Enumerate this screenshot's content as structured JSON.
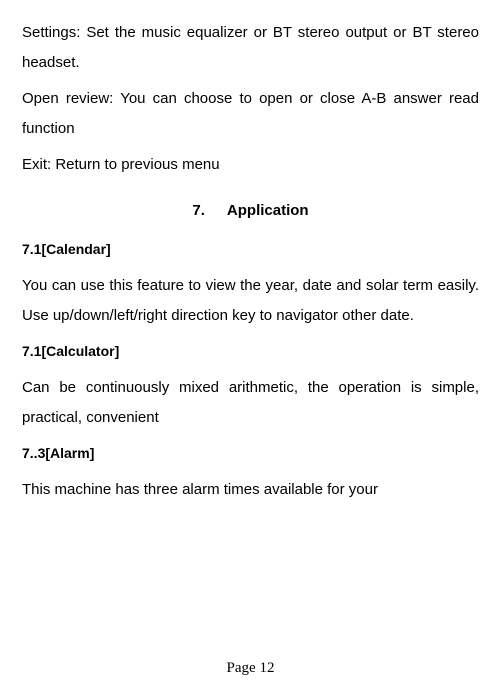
{
  "intro": {
    "settings_text": "Settings: Set the music equalizer or BT stereo output or BT stereo headset.",
    "open_review_text": "Open review: You can choose to open or close A-B answer read function",
    "exit_text": "Exit: Return to previous menu"
  },
  "section": {
    "number": "7.",
    "title": "Application"
  },
  "calendar": {
    "heading": "7.1[Calendar]",
    "body": "You can use this feature to view the year, date and solar term easily. Use up/down/left/right direction key to navigator other date."
  },
  "calculator": {
    "heading": "7.1[Calculator]",
    "body": "Can be continuously mixed arithmetic, the operation is simple, practical, convenient"
  },
  "alarm": {
    "heading": "7..3[Alarm]",
    "body": "This machine has three alarm times available for your"
  },
  "footer": {
    "page_label": "Page 12"
  }
}
